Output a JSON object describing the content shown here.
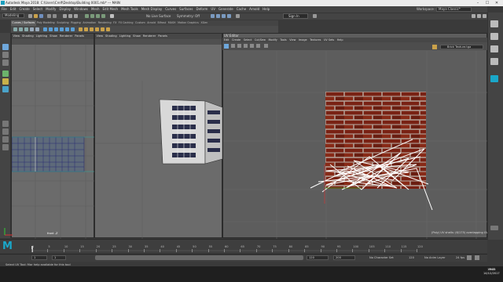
{
  "window": {
    "title": "Autodesk Maya 2018: C:\\Users\\Crelf\\Desktop\\Building 0001.mb* --- MAIN",
    "minimize": "–",
    "maximize": "☐",
    "close": "✕"
  },
  "menubar": {
    "items": [
      "File",
      "Edit",
      "Create",
      "Select",
      "Modify",
      "Display",
      "Windows",
      "Mesh",
      "Edit Mesh",
      "Mesh Tools",
      "Mesh Display",
      "Curves",
      "Surfaces",
      "Deform",
      "UV",
      "Generate",
      "Cache",
      "Arnold",
      "Help"
    ],
    "workspace_label": "Workspace :",
    "workspace_value": "Maya Classic*"
  },
  "status_line": {
    "mode": "Modeling",
    "live_surface": "No Live Surface",
    "symmetry": "Symmetry: Off",
    "sign_in": "Sign In"
  },
  "shelf": {
    "tabs": [
      "Curves / Surfaces",
      "Poly Modeling",
      "Sculpting",
      "Rigging",
      "Animation",
      "Rendering",
      "FX",
      "FX Caching",
      "Custom",
      "Arnold",
      "Bifrost",
      "MASH",
      "Motion Graphics",
      "XGen"
    ],
    "active_tab": "Curves / Surfaces"
  },
  "viewports": [
    {
      "menu": [
        "View",
        "Shading",
        "Lighting",
        "Show",
        "Renderer",
        "Panels"
      ],
      "camera": "front -Z"
    },
    {
      "menu": [
        "View",
        "Shading",
        "Lighting",
        "Show",
        "Renderer",
        "Panels"
      ],
      "camera": ""
    }
  ],
  "uv_editor": {
    "title": "UV Editor",
    "menu": [
      "Edit",
      "Create",
      "Select",
      "Cut/Sew",
      "Modify",
      "Tools",
      "View",
      "Image",
      "Textures",
      "UV Sets",
      "Help"
    ],
    "texture_select": "Brick Texture.tga",
    "info": "(Poly) UV shells: (6/175) overlapping UVs: ..."
  },
  "timeline": {
    "ticks": [
      "1",
      "5",
      "10",
      "15",
      "20",
      "25",
      "30",
      "35",
      "40",
      "45",
      "50",
      "55",
      "60",
      "65",
      "70",
      "75",
      "80",
      "85",
      "90",
      "95",
      "100",
      "105",
      "110",
      "115",
      "120"
    ],
    "current_frame": "1"
  },
  "range": {
    "start": "1",
    "start_inner": "1",
    "end_inner": "120",
    "end": "120",
    "end_outer": "200",
    "character_set": "No Character Set",
    "anim_layer": "No Anim Layer",
    "fps": "24 fps"
  },
  "help_line": "Select UV Tool: Mar help available for this tool",
  "taskbar": {
    "time": "19:15",
    "date": "14/12/2017",
    "lang": "ENG"
  },
  "colors": {
    "accent": "#1aa7c9",
    "brick": "#8e2a1a",
    "uv_lines": "#ffffff"
  }
}
